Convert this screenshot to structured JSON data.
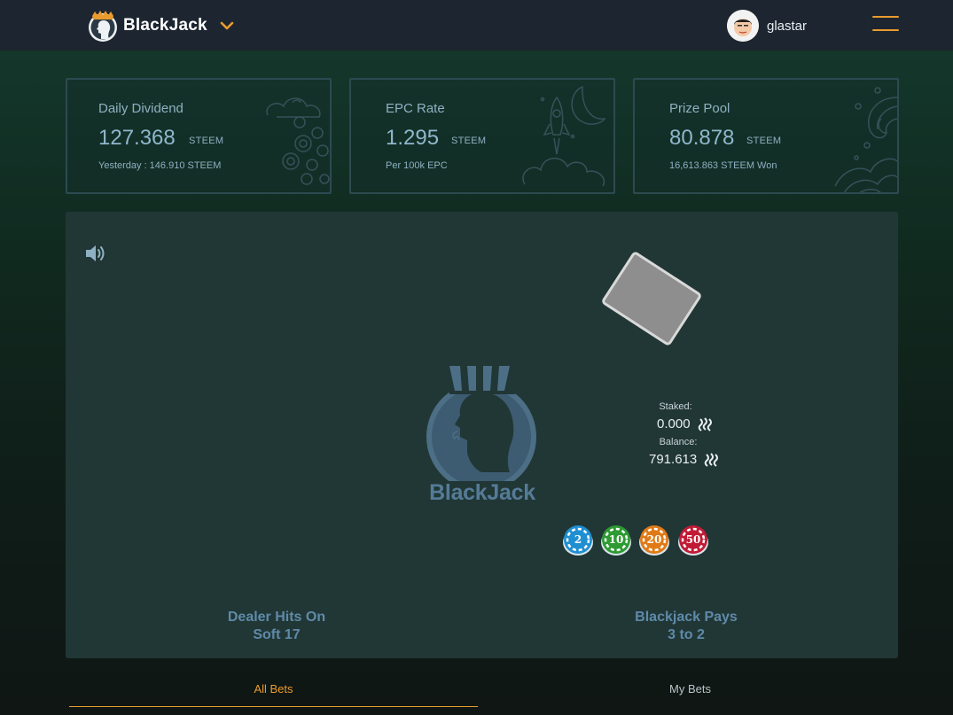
{
  "header": {
    "brand_name": "BlackJack",
    "username": "glastar"
  },
  "stats": [
    {
      "title": "Daily Dividend",
      "value": "127.368",
      "unit": "STEEM",
      "sub": "Yesterday : 146.910 STEEM"
    },
    {
      "title": "EPC Rate",
      "value": "1.295",
      "unit": "STEEM",
      "sub": "Per 100k EPC"
    },
    {
      "title": "Prize Pool",
      "value": "80.878",
      "unit": "STEEM",
      "sub": "16,613.863 STEEM Won"
    }
  ],
  "game": {
    "logo_text": "BlackJack",
    "staked_label": "Staked:",
    "staked_value": "0.000",
    "balance_label": "Balance:",
    "balance_value": "791.613",
    "chips": [
      {
        "label": "2",
        "color": "#1f8fd1"
      },
      {
        "label": "10",
        "color": "#2e9a32"
      },
      {
        "label": "20",
        "color": "#e07a16"
      },
      {
        "label": "50",
        "color": "#c21a35"
      }
    ],
    "rule_left_line1": "Dealer Hits On",
    "rule_left_line2": "Soft 17",
    "rule_right_line1": "Blackjack Pays",
    "rule_right_line2": "3 to 2"
  },
  "tabs": [
    {
      "label": "All Bets",
      "active": true
    },
    {
      "label": "My Bets",
      "active": false
    }
  ],
  "colors": {
    "accent": "#e99b2e",
    "header_bg": "#1d2630",
    "table_bg": "#213736"
  }
}
